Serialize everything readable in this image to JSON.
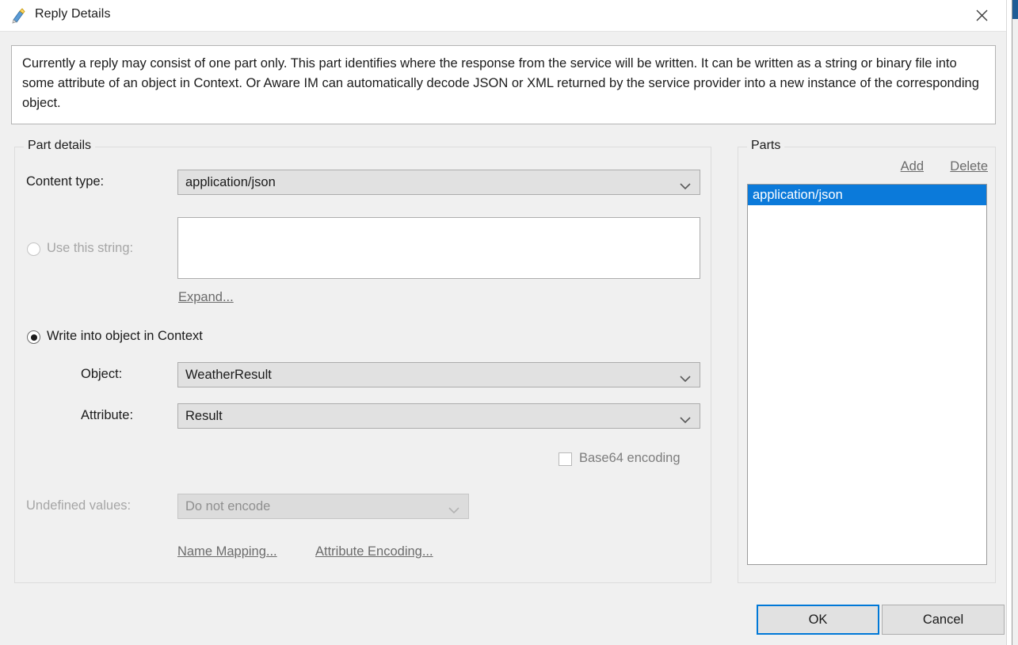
{
  "window": {
    "title": "Reply Details",
    "icon": "pen-document-icon",
    "close_icon": "close-icon"
  },
  "description": "Currently a reply may consist of one part only. This part identifies where the response from the service will be written. It can be written as a string or binary file into some attribute of an object in Context. Or Aware IM can automatically decode JSON or XML returned by the service provider into a new instance of the corresponding object.",
  "part_details": {
    "group_title": "Part details",
    "content_type": {
      "label": "Content type:",
      "value": "application/json",
      "arrow_icon": "chevron-down-icon"
    },
    "use_string": {
      "label": "Use this string:",
      "selected": false,
      "value": "",
      "expand_link": "Expand..."
    },
    "write_object": {
      "label": "Write into object in Context",
      "selected": true,
      "object": {
        "label": "Object:",
        "value": "WeatherResult",
        "arrow_icon": "chevron-down-icon"
      },
      "attribute": {
        "label": "Attribute:",
        "value": "Result",
        "arrow_icon": "chevron-down-icon"
      },
      "base64": {
        "label": "Base64 encoding",
        "checked": false
      }
    },
    "undefined_values": {
      "label": "Undefined values:",
      "value": "Do not encode",
      "arrow_icon": "chevron-down-icon"
    },
    "links": {
      "name_mapping": "Name Mapping...",
      "attribute_encoding": "Attribute Encoding..."
    }
  },
  "parts": {
    "group_title": "Parts",
    "add_label": "Add",
    "delete_label": "Delete",
    "items": [
      {
        "label": "application/json",
        "selected": true
      }
    ]
  },
  "footer": {
    "ok_label": "OK",
    "cancel_label": "Cancel"
  },
  "colors": {
    "selection_blue": "#0b7ada",
    "focus_blue": "#0078d7",
    "dialog_bg": "#f0f0f0",
    "control_bg": "#e1e1e1"
  }
}
